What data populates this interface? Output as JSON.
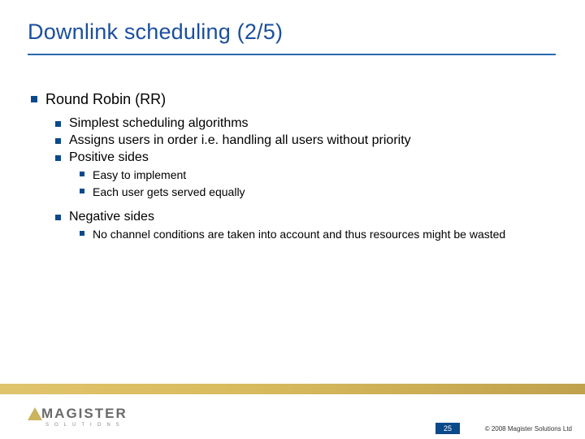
{
  "title": "Downlink scheduling (2/5)",
  "content": {
    "h1": "Round Robin (RR)",
    "points": {
      "p1": "Simplest scheduling algorithms",
      "p2": "Assigns users in order i.e. handling all users without priority",
      "p3": "Positive sides",
      "p3a": "Easy to implement",
      "p3b": "Each user gets served equally",
      "p4": "Negative sides",
      "p4a": "No channel conditions are taken into account and thus resources might be wasted"
    }
  },
  "footer": {
    "logo_word": "MAGISTER",
    "logo_sub": "SOLUTIONS",
    "page": "25",
    "copyright": "© 2008 Magister Solutions Ltd"
  }
}
